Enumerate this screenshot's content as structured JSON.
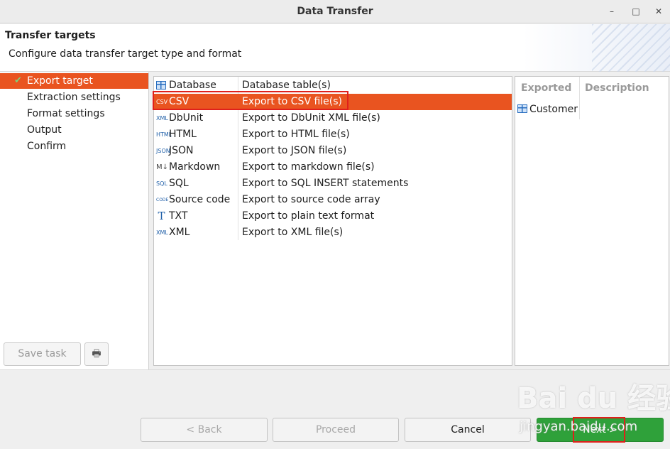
{
  "window": {
    "title": "Data Transfer",
    "minimize_glyph": "–",
    "maximize_glyph": "□",
    "close_glyph": "✕"
  },
  "header": {
    "title": "Transfer targets",
    "subtitle": "Configure data transfer target type and format"
  },
  "nav": {
    "items": [
      {
        "label": "Export target",
        "active": true,
        "checked": true
      },
      {
        "label": "Extraction settings"
      },
      {
        "label": "Format settings"
      },
      {
        "label": "Output"
      },
      {
        "label": "Confirm"
      }
    ],
    "check_glyph": "✔",
    "save_task_label": "Save task",
    "save_icon": "printer-icon",
    "save_icon_glyph": "🖶"
  },
  "targets": [
    {
      "name": "Database",
      "desc": "Database table(s)",
      "icon": "database-table-icon",
      "icon_text": ""
    },
    {
      "name": "CSV",
      "desc": "Export to CSV file(s)",
      "icon": "csv-file-icon",
      "icon_text": "CSV",
      "selected": true
    },
    {
      "name": "DbUnit",
      "desc": "Export to DbUnit XML file(s)",
      "icon": "xml-file-icon",
      "icon_text": "XML"
    },
    {
      "name": "HTML",
      "desc": "Export to HTML file(s)",
      "icon": "html-file-icon",
      "icon_text": "HTML"
    },
    {
      "name": "JSON",
      "desc": "Export to JSON file(s)",
      "icon": "json-file-icon",
      "icon_text": "JSON"
    },
    {
      "name": "Markdown",
      "desc": "Export to markdown file(s)",
      "icon": "markdown-icon",
      "icon_text": "M↓"
    },
    {
      "name": "SQL",
      "desc": "Export to SQL INSERT statements",
      "icon": "sql-file-icon",
      "icon_text": "SQL"
    },
    {
      "name": "Source code",
      "desc": "Export to source code array",
      "icon": "code-file-icon",
      "icon_text": "CODE"
    },
    {
      "name": "TXT",
      "desc": "Export to plain text format",
      "icon": "text-t-icon",
      "icon_text": "T"
    },
    {
      "name": "XML",
      "desc": "Export to XML file(s)",
      "icon": "xml-file-icon",
      "icon_text": "XML"
    }
  ],
  "exported": {
    "headers": [
      "Exported",
      "Description"
    ],
    "rows": [
      {
        "name": "Customer",
        "icon": "table-icon"
      }
    ]
  },
  "footer": {
    "back": "< Back",
    "proceed": "Proceed",
    "cancel": "Cancel",
    "next": "Next >"
  },
  "watermark": {
    "logo_text": "Bai du 经验",
    "url": "jingyan.baidu.com"
  },
  "colors": {
    "accent": "#e95420",
    "primary_button": "#2fa13a",
    "highlight_box": "#e0201b"
  }
}
